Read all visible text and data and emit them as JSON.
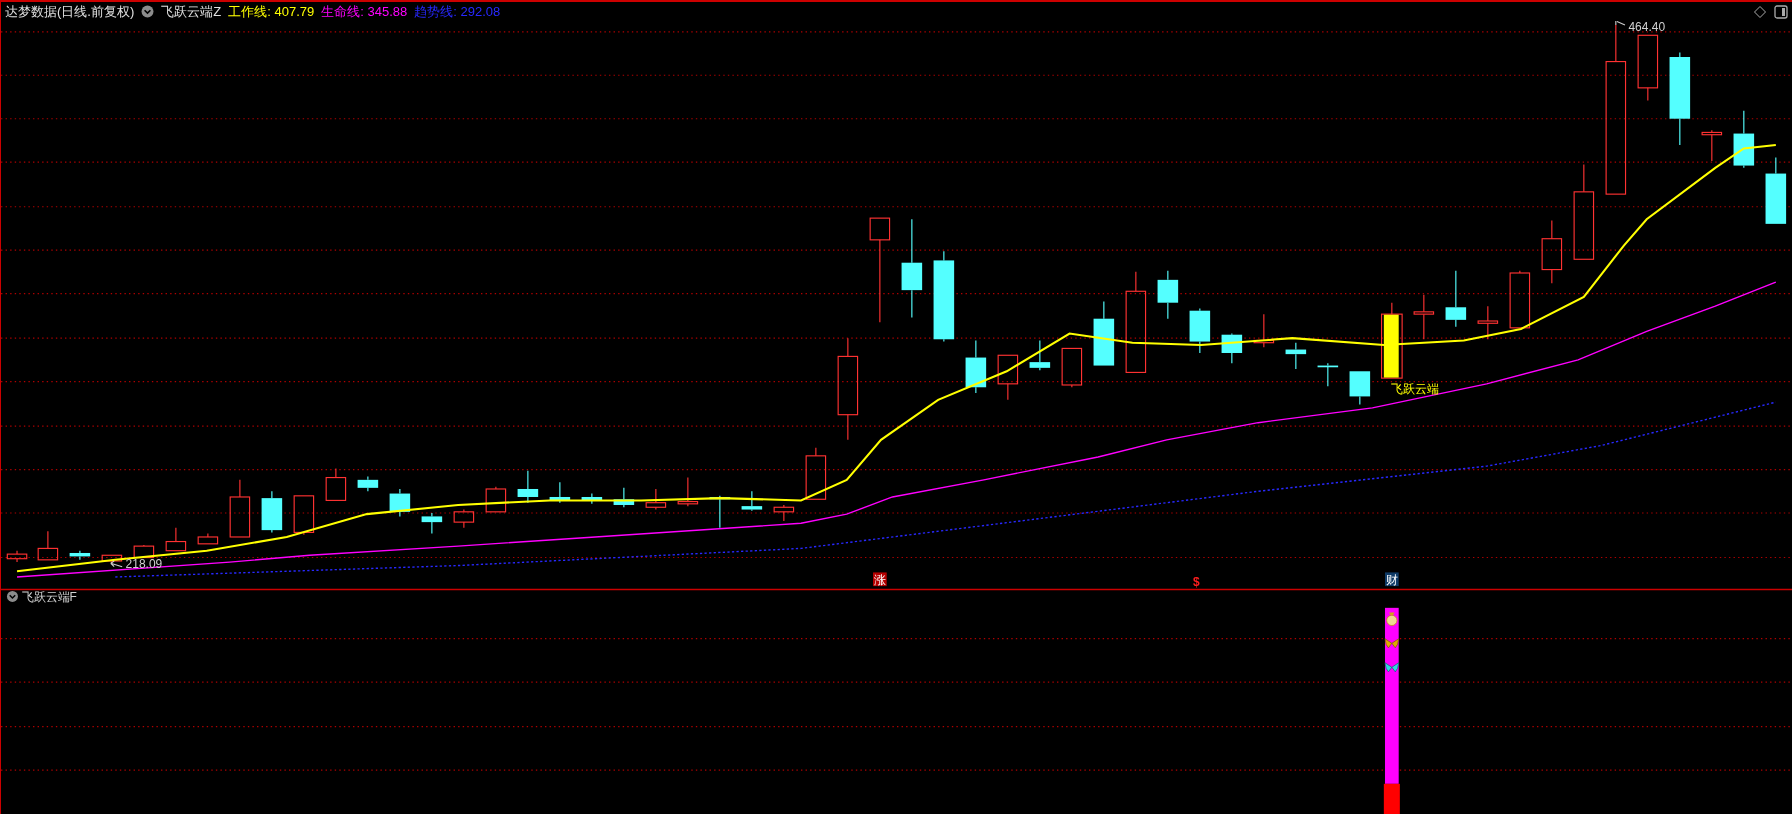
{
  "header": {
    "title": "达梦数据(日线.前复权)",
    "indicator": "飞跃云端Z",
    "lines": [
      {
        "label": "工作线: 407.79",
        "color": "#ffff00"
      },
      {
        "label": "生命线: 345.88",
        "color": "#ff00ff"
      },
      {
        "label": "趋势线: 292.08",
        "color": "#2828ff"
      }
    ]
  },
  "main_chart": {
    "high_label": "464.40",
    "low_label": "218.09",
    "signal_label": "飞跃云端",
    "markers": [
      {
        "kind": "badge",
        "text": "涨",
        "color": "#b40000"
      },
      {
        "kind": "sign",
        "text": "$",
        "color": "#ff1e1e"
      },
      {
        "kind": "badge",
        "text": "财",
        "color": "#0e3a66"
      }
    ]
  },
  "sub_panel": {
    "title": "飞跃云端F"
  }
}
